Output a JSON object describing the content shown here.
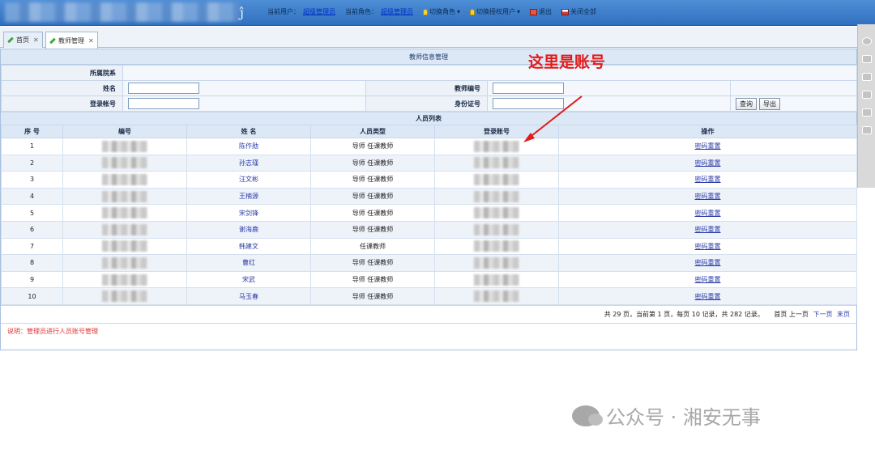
{
  "header": {
    "current_user_label": "当前用户：",
    "current_user_value": "超级管理员",
    "current_role_label": "当前角色：",
    "current_role_value": "超级管理员",
    "switch_role": "切换角色",
    "switch_auth_user": "切换授权用户",
    "logout": "退出",
    "close_all": "关闭全部"
  },
  "tabs": [
    {
      "label": "首页",
      "active": false
    },
    {
      "label": "教师管理",
      "active": true
    }
  ],
  "panel": {
    "title": "教师信息管理",
    "college_label": "所属院系",
    "name_label": "姓名",
    "teacher_no_label": "教师编号",
    "login_account_label": "登录帐号",
    "id_card_label": "身份证号",
    "search_button": "查询",
    "export_button": "导出"
  },
  "list": {
    "title": "人员列表",
    "columns": [
      "序 号",
      "编号",
      "姓 名",
      "人员类型",
      "登录账号",
      "操作"
    ],
    "rows": [
      {
        "index": "1",
        "name": "陈作勋",
        "type": "导师  任课教师",
        "action": "密码重置"
      },
      {
        "index": "2",
        "name": "孙志瑾",
        "type": "导师  任课教师",
        "action": "密码重置"
      },
      {
        "index": "3",
        "name": "汪文彬",
        "type": "导师  任课教师",
        "action": "密码重置"
      },
      {
        "index": "4",
        "name": "王楠源",
        "type": "导师  任课教师",
        "action": "密码重置"
      },
      {
        "index": "5",
        "name": "宋剑锋",
        "type": "导师  任课教师",
        "action": "密码重置"
      },
      {
        "index": "6",
        "name": "谢海鹿",
        "type": "导师  任课教师",
        "action": "密码重置"
      },
      {
        "index": "7",
        "name": "韩建文",
        "type": "任课教师",
        "action": "密码重置"
      },
      {
        "index": "8",
        "name": "曹红",
        "type": "导师  任课教师",
        "action": "密码重置"
      },
      {
        "index": "9",
        "name": "宋武",
        "type": "导师  任课教师",
        "action": "密码重置"
      },
      {
        "index": "10",
        "name": "马玉春",
        "type": "导师  任课教师",
        "action": "密码重置"
      }
    ]
  },
  "pagination": {
    "summary": "共 29 页，当前第 1 页，每页 10 记录，共 282 记录。",
    "first": "首页",
    "prev": "上一页",
    "next": "下一页",
    "last": "末页"
  },
  "note": "说明：管理员进行人员账号管理",
  "annotation": "这里是账号",
  "watermark": "公众号 · 湘安无事",
  "colors": {
    "header_bg": "#3f7fca",
    "panel_header_bg": "#dde8f6",
    "link": "#2a3aa8",
    "annotation": "#e21a1a",
    "note": "#e03030"
  }
}
